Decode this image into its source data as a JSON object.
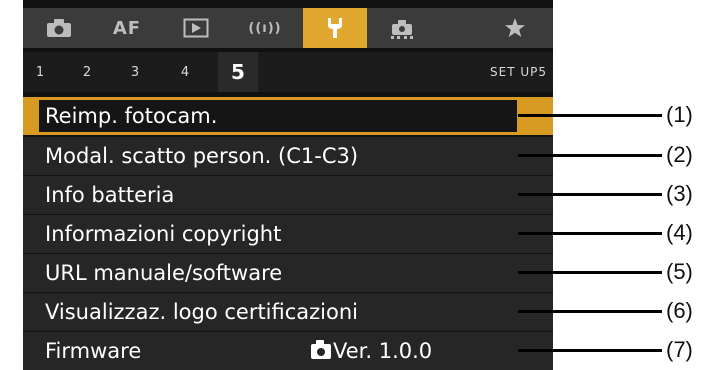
{
  "tabs": [
    {
      "icon": "camera-icon",
      "label": ""
    },
    {
      "icon": "af-icon",
      "label": "AF"
    },
    {
      "icon": "playback-icon",
      "label": ""
    },
    {
      "icon": "wireless-icon",
      "label": "((ı))"
    },
    {
      "icon": "wrench-icon",
      "label": "",
      "active": true
    },
    {
      "icon": "custom-functions-icon",
      "label": ""
    },
    {
      "icon": "star-icon",
      "label": ""
    }
  ],
  "subtabs": [
    "1",
    "2",
    "3",
    "4",
    "5"
  ],
  "active_subtab": "5",
  "page_title": "SET UP5",
  "menu": [
    {
      "label": "Reimp. fotocam.",
      "callout": "(1)",
      "selected": true
    },
    {
      "label": "Modal. scatto person. (C1-C3)",
      "callout": "(2)"
    },
    {
      "label": "Info batteria",
      "callout": "(3)"
    },
    {
      "label": "Informazioni copyright",
      "callout": "(4)"
    },
    {
      "label": "URL manuale/software",
      "callout": "(5)"
    },
    {
      "label": "Visualizzaz. logo certificazioni",
      "callout": "(6)"
    },
    {
      "label": "Firmware",
      "value": "Ver. 1.0.0",
      "callout": "(7)"
    }
  ],
  "colors": {
    "accent": "#e0a82e",
    "selection": "#d79a22",
    "row_bg": "#262626",
    "screen_bg": "#111111"
  }
}
